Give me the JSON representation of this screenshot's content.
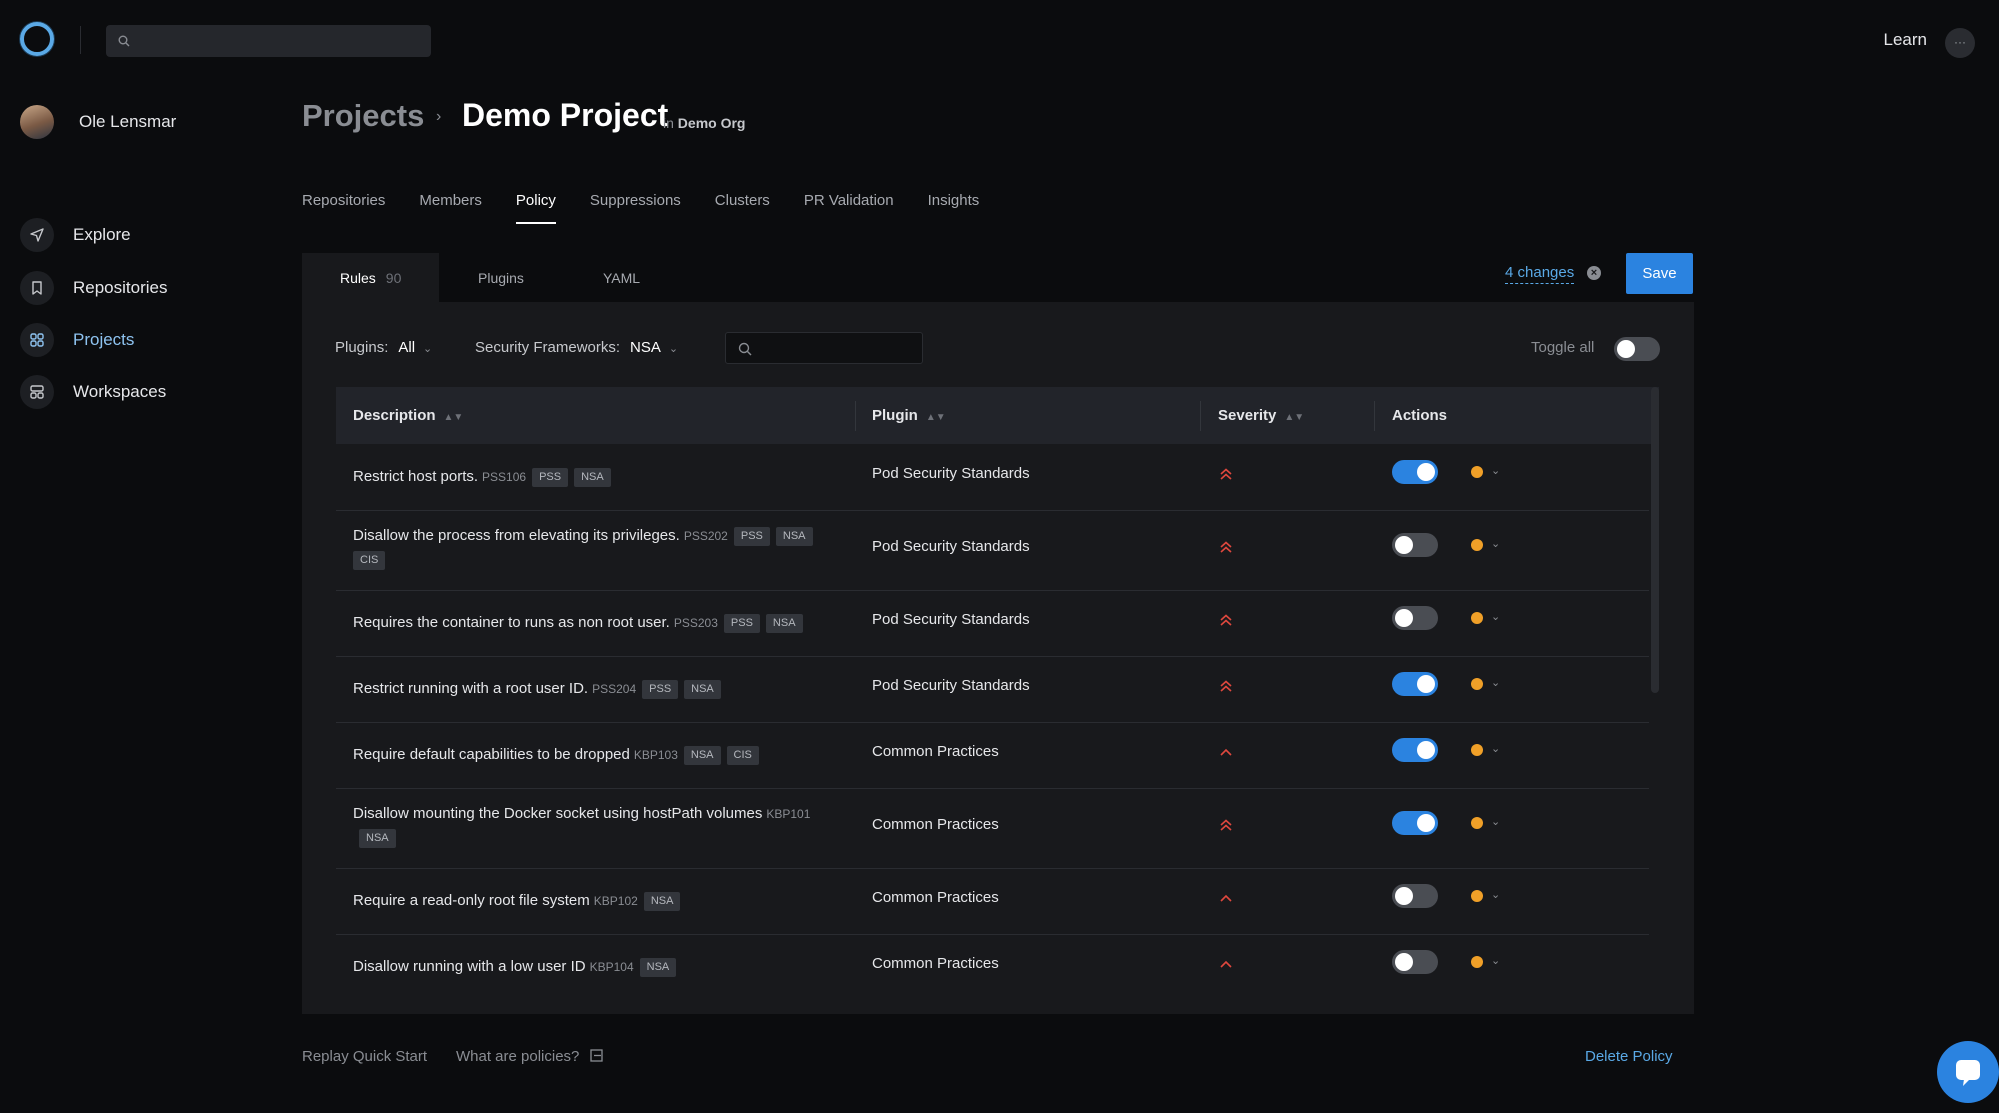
{
  "app": {
    "learn_label": "Learn",
    "more_label": "···"
  },
  "user": {
    "name": "Ole Lensmar"
  },
  "sidebar": {
    "items": [
      {
        "label": "Explore",
        "icon": "paper-plane-icon"
      },
      {
        "label": "Repositories",
        "icon": "bookmark-icon"
      },
      {
        "label": "Projects",
        "icon": "grid-icon",
        "active": true
      },
      {
        "label": "Workspaces",
        "icon": "workspaces-icon"
      }
    ]
  },
  "breadcrumb": {
    "parent": "Projects",
    "separator": "›",
    "current": "Demo Project",
    "org_prefix": "in",
    "org": "Demo Org"
  },
  "tabs": [
    "Repositories",
    "Members",
    "Policy",
    "Suppressions",
    "Clusters",
    "PR Validation",
    "Insights"
  ],
  "active_tab": "Policy",
  "subtabs": {
    "rules_label": "Rules",
    "rules_count": "90",
    "plugins_label": "Plugins",
    "yaml_label": "YAML"
  },
  "changes": {
    "label": "4 changes",
    "clear": "×"
  },
  "save_label": "Save",
  "filters": {
    "plugins_label": "Plugins:",
    "plugins_value": "All",
    "frameworks_label": "Security Frameworks:",
    "frameworks_value": "NSA",
    "toggle_all_label": "Toggle all",
    "toggle_all_on": false
  },
  "table": {
    "headers": {
      "description": "Description",
      "plugin": "Plugin",
      "severity": "Severity",
      "actions": "Actions"
    },
    "rows": [
      {
        "description": "Restrict host ports.",
        "id": "PSS106",
        "tags": [
          "PSS",
          "NSA"
        ],
        "plugin": "Pod Security Standards",
        "severity": "high",
        "enabled": true
      },
      {
        "description": "Disallow the process from elevating its privileges.",
        "id": "PSS202",
        "tags": [
          "PSS",
          "NSA",
          "CIS"
        ],
        "plugin": "Pod Security Standards",
        "severity": "high",
        "enabled": false
      },
      {
        "description": "Requires the container to runs as non root user.",
        "id": "PSS203",
        "tags": [
          "PSS",
          "NSA"
        ],
        "plugin": "Pod Security Standards",
        "severity": "high",
        "enabled": false
      },
      {
        "description": "Restrict running with a root user ID.",
        "id": "PSS204",
        "tags": [
          "PSS",
          "NSA"
        ],
        "plugin": "Pod Security Standards",
        "severity": "high",
        "enabled": true
      },
      {
        "description": "Require default capabilities to be dropped",
        "id": "KBP103",
        "tags": [
          "NSA",
          "CIS"
        ],
        "plugin": "Common Practices",
        "severity": "medium",
        "enabled": true
      },
      {
        "description": "Disallow mounting the Docker socket using hostPath volumes",
        "id": "KBP101",
        "tags": [
          "NSA"
        ],
        "plugin": "Common Practices",
        "severity": "high",
        "enabled": true
      },
      {
        "description": "Require a read-only root file system",
        "id": "KBP102",
        "tags": [
          "NSA"
        ],
        "plugin": "Common Practices",
        "severity": "medium",
        "enabled": false
      },
      {
        "description": "Disallow running with a low user ID",
        "id": "KBP104",
        "tags": [
          "NSA"
        ],
        "plugin": "Common Practices",
        "severity": "medium",
        "enabled": false
      }
    ]
  },
  "footer": {
    "replay_label": "Replay Quick Start",
    "policies_link": "What are policies?",
    "delete_label": "Delete Policy"
  },
  "colors": {
    "accent": "#2b83e0",
    "severity": "#e0483e",
    "warning_dot": "#f0a028",
    "background": "#0b0c0e",
    "panel": "#18191c"
  }
}
